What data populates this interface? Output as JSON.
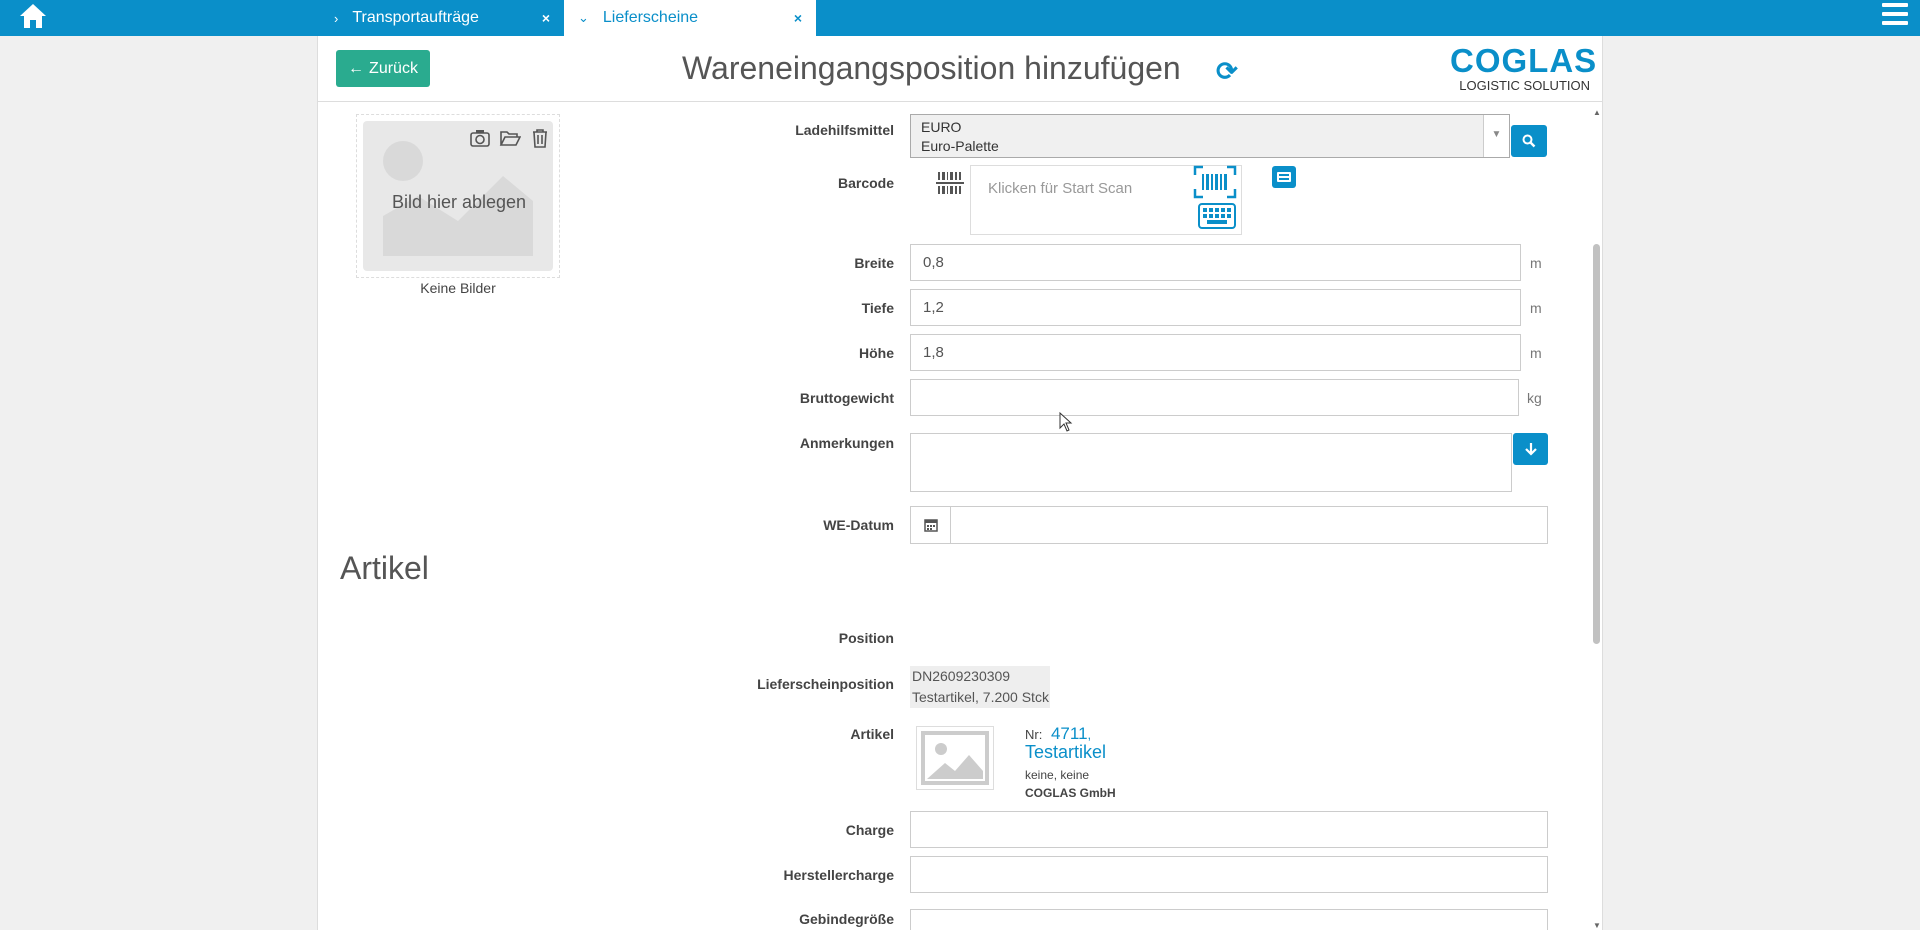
{
  "tabs": [
    {
      "label": "Transportaufträge",
      "chevron": "›",
      "close": "×"
    },
    {
      "label": "Lieferscheine",
      "chevron": "⌄",
      "close": "×"
    }
  ],
  "header": {
    "back_label": "Zurück",
    "title": "Wareneingangsposition hinzufügen",
    "logo_big": "COGLAS",
    "logo_small": "LOGISTIC SOLUTION"
  },
  "image": {
    "drop_text": "Bild hier ablegen",
    "no_images": "Keine Bilder"
  },
  "form": {
    "ladehilfsmittel_label": "Ladehilfsmittel",
    "ladehilfsmittel_code": "EURO",
    "ladehilfsmittel_name": "Euro-Palette",
    "barcode_label": "Barcode",
    "barcode_placeholder": "Klicken für Start Scan",
    "breite_label": "Breite",
    "breite_value": "0,8",
    "breite_unit": "m",
    "tiefe_label": "Tiefe",
    "tiefe_value": "1,2",
    "tiefe_unit": "m",
    "hoehe_label": "Höhe",
    "hoehe_value": "1,8",
    "hoehe_unit": "m",
    "brutto_label": "Bruttogewicht",
    "brutto_value": "",
    "brutto_unit": "kg",
    "anmerkungen_label": "Anmerkungen",
    "we_datum_label": "WE-Datum",
    "we_datum_value": ""
  },
  "artikel": {
    "section_title": "Artikel",
    "position_label": "Position",
    "lieferscheinposition_label": "Lieferscheinposition",
    "lieferscheinposition_line1": "DN2609230309",
    "lieferscheinposition_line2": "Testartikel, 7.200 Stck",
    "artikel_label": "Artikel",
    "nr_label": "Nr:",
    "nr_value": "4711",
    "name": "Testartikel",
    "variant": "keine, keine",
    "company": "COGLAS GmbH",
    "charge_label": "Charge",
    "herstellercharge_label": "Herstellercharge",
    "gebindegroesse_label": "Gebindegröße"
  },
  "colors": {
    "accent": "#0a8fc9",
    "back_button": "#2aab8f"
  },
  "icons": [
    "home-icon",
    "menu-icon",
    "refresh-icon",
    "camera-icon",
    "folder-open-icon",
    "trash-icon",
    "search-icon",
    "barcode-icon",
    "scan-icon",
    "keyboard-icon",
    "arrow-down-icon",
    "calendar-icon",
    "image-placeholder-icon"
  ]
}
